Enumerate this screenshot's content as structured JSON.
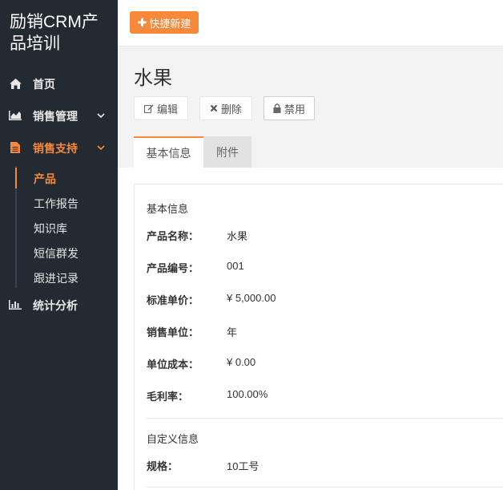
{
  "app": {
    "brand": "励销CRM产品培训"
  },
  "sidebar": {
    "items": [
      {
        "label": "首页",
        "icon": "home-icon"
      },
      {
        "label": "销售管理",
        "icon": "area-chart-icon",
        "expanded": false
      },
      {
        "label": "销售支持",
        "icon": "document-icon",
        "expanded": true,
        "active": true
      },
      {
        "label": "统计分析",
        "icon": "bar-chart-icon"
      }
    ],
    "sub_items": [
      {
        "label": "产品",
        "active": true
      },
      {
        "label": "工作报告"
      },
      {
        "label": "知识库"
      },
      {
        "label": "短信群发"
      },
      {
        "label": "跟进记录"
      }
    ]
  },
  "toolbar": {
    "quick_new_label": "快捷新建"
  },
  "page": {
    "title": "水果",
    "actions": {
      "edit": "编辑",
      "delete": "删除",
      "disable": "禁用"
    },
    "tabs": [
      {
        "label": "基本信息",
        "active": true
      },
      {
        "label": "附件"
      }
    ]
  },
  "details": {
    "basic_section_title": "基本信息",
    "fields": [
      {
        "label": "产品名称：",
        "value": "水果"
      },
      {
        "label": "产品编号：",
        "value": "001"
      },
      {
        "label": "标准单价：",
        "value": "¥ 5,000.00"
      },
      {
        "label": "销售单位：",
        "value": "年"
      },
      {
        "label": "单位成本：",
        "value": "¥ 0.00"
      },
      {
        "label": "毛利率：",
        "value": "100.00%"
      }
    ],
    "custom_section_title": "自定义信息",
    "custom_fields": [
      {
        "label": "规格：",
        "value": "10工号"
      }
    ]
  },
  "colors": {
    "accent": "#f7893b",
    "sidebar_bg": "#242a32"
  }
}
